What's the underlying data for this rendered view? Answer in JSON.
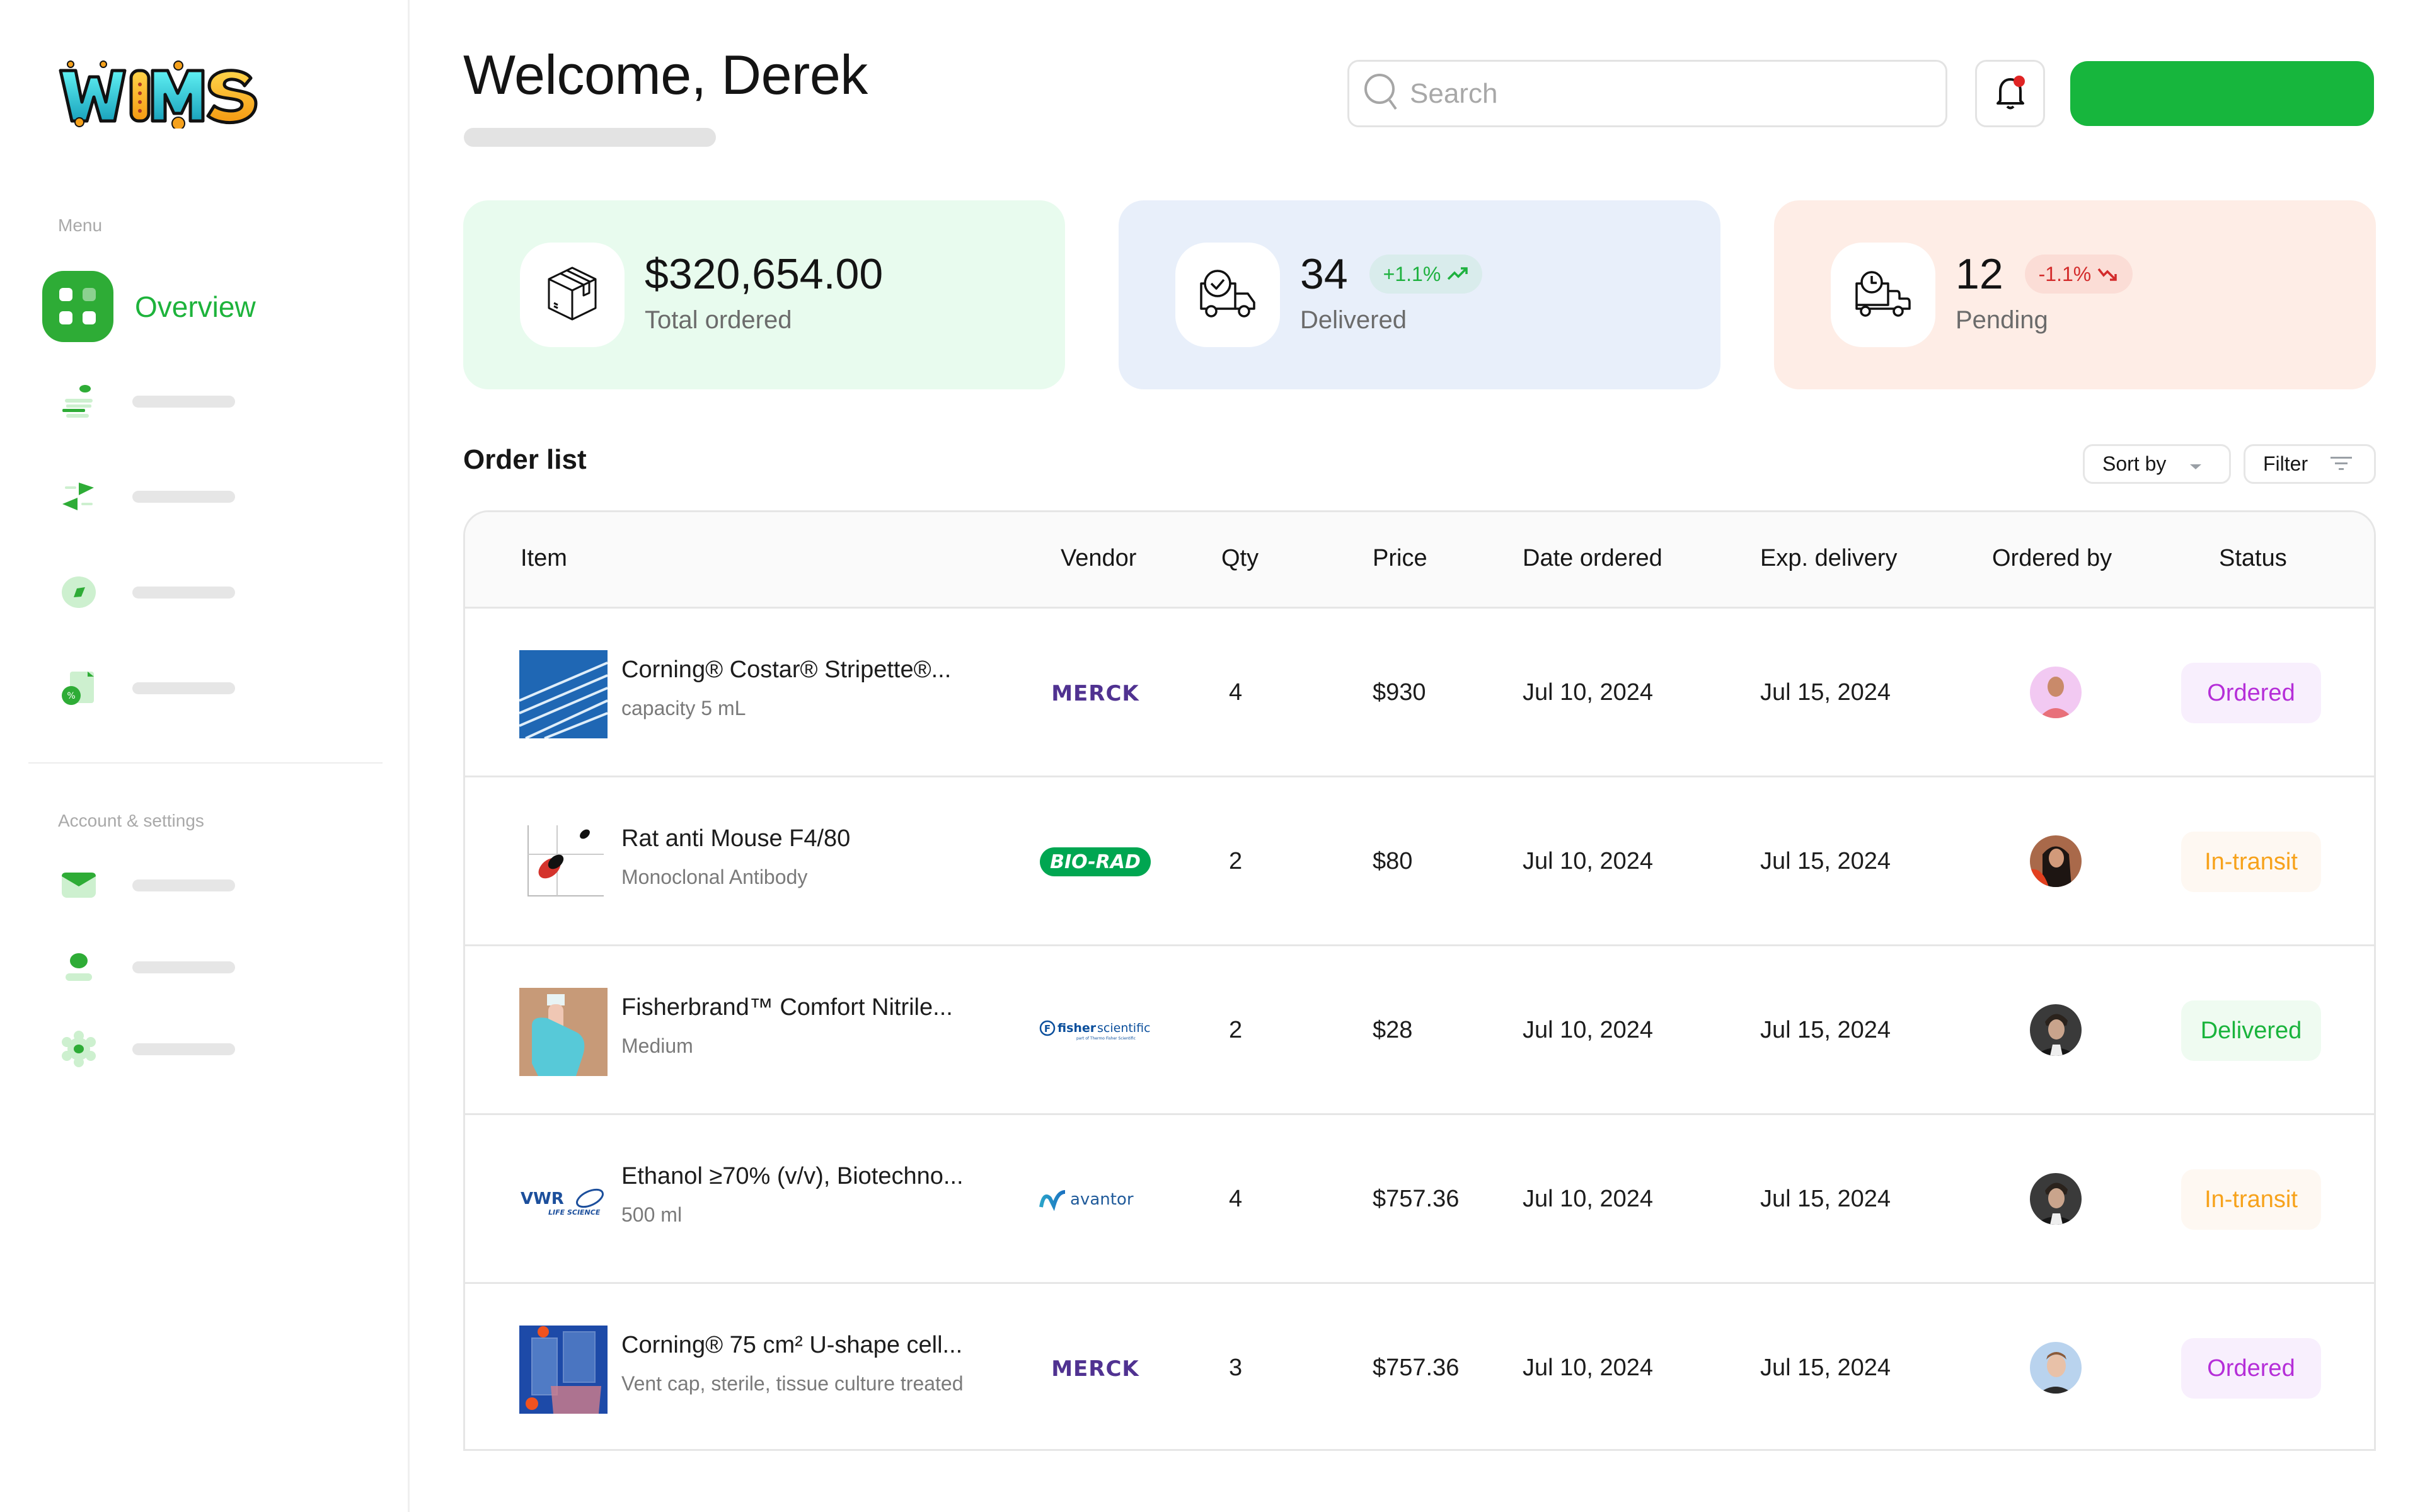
{
  "app": {
    "logo_text": "WIMS"
  },
  "sidebar": {
    "menu_label": "Menu",
    "active_item": {
      "label": "Overview",
      "icon": "grid-icon"
    },
    "menu_items": [
      {
        "icon": "inventory-icon"
      },
      {
        "icon": "transfer-icon"
      },
      {
        "icon": "compass-icon"
      },
      {
        "icon": "invoice-icon"
      }
    ],
    "account_label": "Account & settings",
    "account_items": [
      {
        "icon": "mail-icon"
      },
      {
        "icon": "user-icon"
      },
      {
        "icon": "settings-icon"
      }
    ]
  },
  "header": {
    "greeting": "Welcome, Derek",
    "search_placeholder": "Search",
    "search_value": "",
    "notification_badge": true,
    "primary_button_label": ""
  },
  "stats": [
    {
      "value": "$320,654.00",
      "caption": "Total ordered",
      "icon": "box-icon",
      "bg": "#e8fbee"
    },
    {
      "value": "34",
      "caption": "Delivered",
      "icon": "truck-check-icon",
      "bg": "#e8effa",
      "trend": "+1.1%",
      "trend_dir": "up"
    },
    {
      "value": "12",
      "caption": "Pending",
      "icon": "truck-clock-icon",
      "bg": "#feede6",
      "trend": "-1.1%",
      "trend_dir": "down"
    }
  ],
  "orders": {
    "title": "Order list",
    "sort_label": "Sort by",
    "filter_label": "Filter",
    "columns": [
      "Item",
      "Vendor",
      "Qty",
      "Price",
      "Date ordered",
      "Exp. delivery",
      "Ordered by",
      "Status"
    ],
    "rows": [
      {
        "name": "Corning® Costar® Stripette®...",
        "desc": "capacity 5 mL",
        "vendor": "Merck",
        "qty": "4",
        "price": "$930",
        "date_ordered": "Jul 10, 2024",
        "exp_delivery": "Jul 15, 2024",
        "status": "Ordered",
        "status_type": "ordered",
        "thumb": "pipettes",
        "avatar": "pink"
      },
      {
        "name": "Rat anti Mouse F4/80",
        "desc": "Monoclonal Antibody",
        "vendor": "Bio-Rad",
        "qty": "2",
        "price": "$80",
        "date_ordered": "Jul 10, 2024",
        "exp_delivery": "Jul 15, 2024",
        "status": "In-transit",
        "status_type": "transit",
        "thumb": "scatter",
        "avatar": "woman"
      },
      {
        "name": "Fisherbrand™ Comfort Nitrile...",
        "desc": "Medium",
        "vendor": "Fisher Scientific",
        "qty": "2",
        "price": "$28",
        "date_ordered": "Jul 10, 2024",
        "exp_delivery": "Jul 15, 2024",
        "status": "Delivered",
        "status_type": "delivered",
        "thumb": "glove",
        "avatar": "dark"
      },
      {
        "name": "Ethanol ≥70% (v/v), Biotechno...",
        "desc": "500 ml",
        "vendor": "Avantor",
        "qty": "4",
        "price": "$757.36",
        "date_ordered": "Jul 10, 2024",
        "exp_delivery": "Jul 15, 2024",
        "status": "In-transit",
        "status_type": "transit",
        "thumb": "vwr",
        "avatar": "dark"
      },
      {
        "name": "Corning® 75 cm² U-shape cell...",
        "desc": "Vent cap, sterile, tissue culture treated",
        "vendor": "Merck",
        "qty": "3",
        "price": "$757.36",
        "date_ordered": "Jul 10, 2024",
        "exp_delivery": "Jul 15, 2024",
        "status": "Ordered",
        "status_type": "ordered",
        "thumb": "flask",
        "avatar": "blue"
      }
    ]
  },
  "colors": {
    "accent": "#17b63d",
    "ordered": "#b52ed8",
    "transit": "#f7a21b",
    "delivered": "#19b43c",
    "merck": "#503291",
    "biorad": "#00a651",
    "fisher": "#0b4f9c"
  }
}
